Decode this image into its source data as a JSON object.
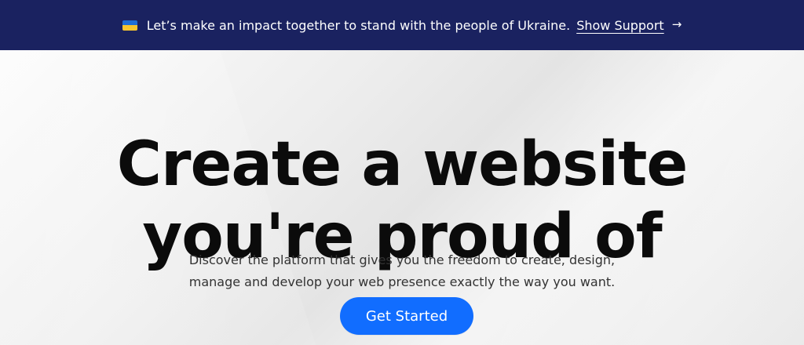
{
  "banner": {
    "flag_icon": "ukraine-flag-icon",
    "flag_colors": {
      "blue": "#1f6fd6",
      "yellow": "#f7c62f"
    },
    "text": "Let’s make an impact together to stand with the people of Ukraine.",
    "link_label": "Show Support",
    "arrow_icon": "arrow-right-icon",
    "arrow_glyph": "→",
    "background": "#1a2260",
    "text_color": "#ffffff"
  },
  "hero": {
    "headline_line_1": "Create a website",
    "headline_line_2": "you're proud of",
    "description_line_1": "Discover the platform that gives you the freedom to create, design,",
    "description_line_2": "manage and develop your web presence exactly the way you want.",
    "cta_label": "Get Started",
    "cta_color": "#116dff"
  }
}
